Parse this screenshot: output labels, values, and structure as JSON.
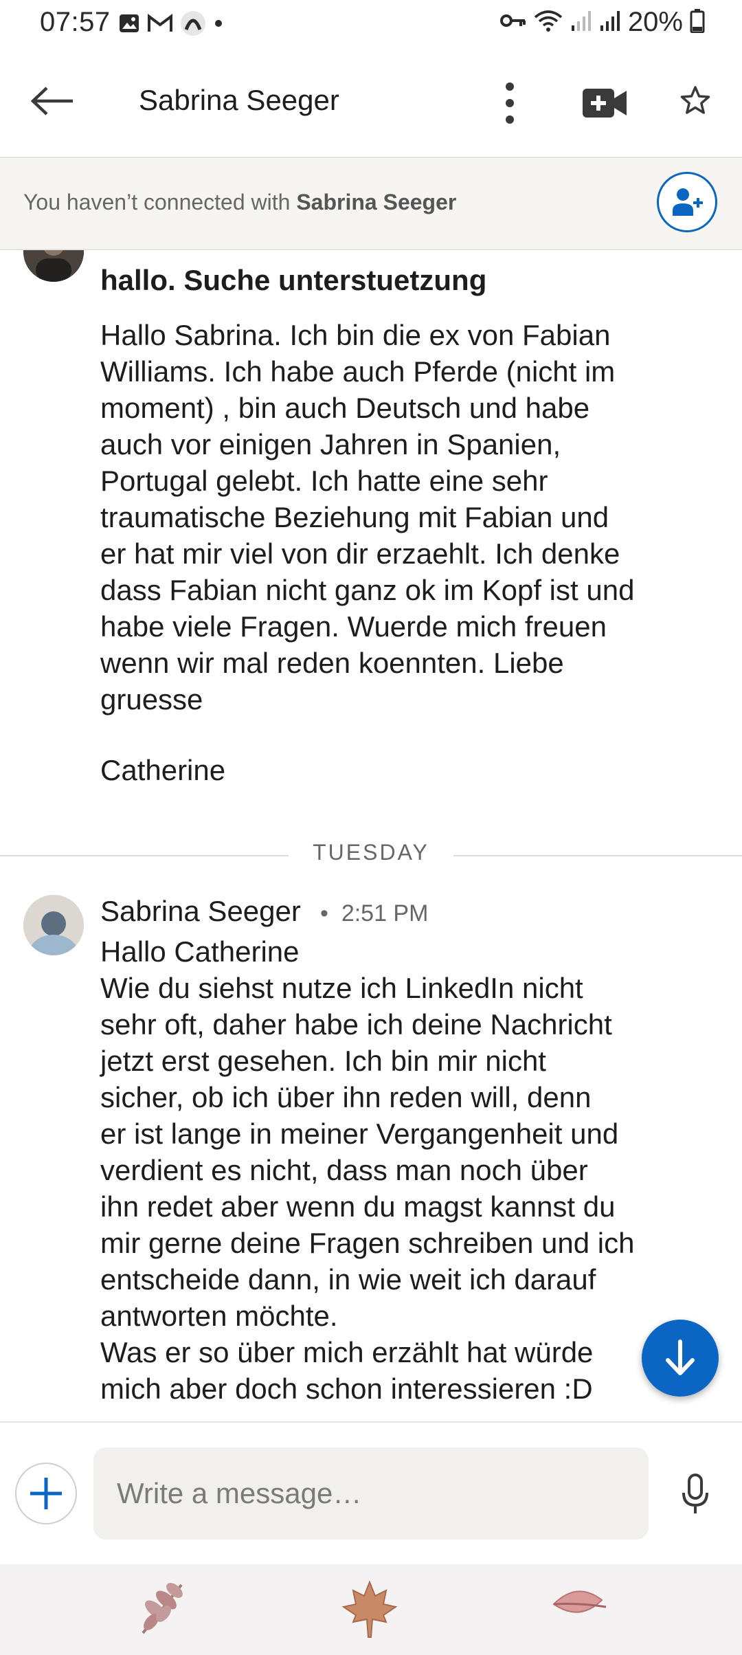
{
  "status_bar": {
    "time": "07:57",
    "battery_percent": "20%",
    "left_icons": [
      "gallery-icon",
      "gmail-icon",
      "app-icon",
      "dot-icon"
    ],
    "right_icons": [
      "vpn-key-icon",
      "wifi-icon",
      "signal-icon",
      "signal-icon",
      "battery-icon"
    ]
  },
  "header": {
    "title": "Sabrina Seeger",
    "icons": [
      "back-arrow-icon",
      "more-vert-icon",
      "video-call-icon",
      "star-icon"
    ]
  },
  "connection_banner": {
    "prefix": "You haven’t connected with ",
    "name": "Sabrina Seeger",
    "icon": "add-person-icon"
  },
  "messages": [
    {
      "subject": "hallo. Suche unterstuetzung",
      "body": "Hallo Sabrina. Ich bin die ex von Fabian\nWilliams. Ich habe auch Pferde (nicht im\nmoment) , bin auch Deutsch und habe\nauch vor einigen Jahren in Spanien,\nPortugal gelebt. Ich hatte eine sehr\ntraumatische Beziehung mit Fabian und\ner hat mir viel von dir erzaehlt. Ich denke\ndass Fabian nicht ganz ok im Kopf ist und\nhabe viele Fragen. Wuerde mich freuen\nwenn wir mal reden koennten. Liebe\ngruesse",
      "signature": "Catherine"
    },
    {
      "sender": "Sabrina Seeger",
      "separator": "•",
      "time": "2:51 PM",
      "body": "Hallo Catherine\nWie du siehst nutze ich LinkedIn nicht\nsehr oft, daher habe ich deine Nachricht\njetzt erst gesehen. Ich bin mir nicht\nsicher, ob ich über ihn reden will, denn\ner ist lange in meiner Vergangenheit und\nverdient es nicht, dass man noch über\nihn redet aber wenn du magst kannst du\nmir gerne deine Fragen schreiben und ich\nentscheide dann, in wie weit ich darauf\nantworten möchte.\nWas er so über mich erzählt hat würde\nmich aber doch schon interessieren :D"
    }
  ],
  "day_divider": "TUESDAY",
  "composer": {
    "placeholder": "Write a message…",
    "icons": [
      "add-icon",
      "microphone-icon"
    ]
  },
  "scroll_button_icon": "arrow-down-icon",
  "bottom_bar_icons": [
    "leaf-icon",
    "maple-leaf-icon",
    "leaf-icon"
  ],
  "colors": {
    "accent": "#0a66c2",
    "banner_bg": "#f6f5f2",
    "input_bg": "#f1f0ec"
  }
}
